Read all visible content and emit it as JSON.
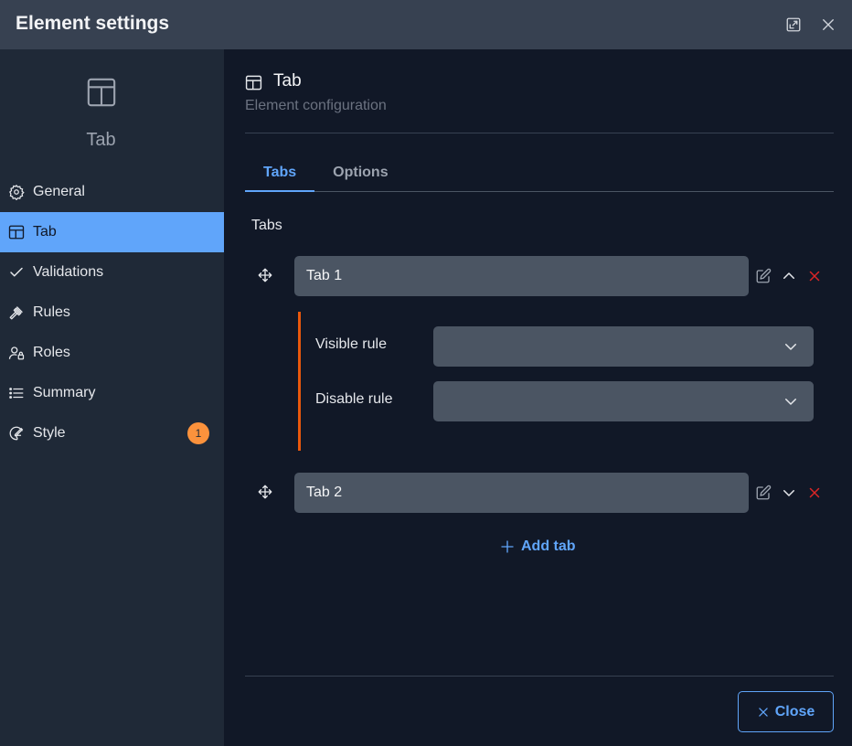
{
  "window": {
    "title": "Element settings"
  },
  "sidebar": {
    "element_label": "Tab",
    "items": [
      {
        "label": "General",
        "icon": "gear-icon"
      },
      {
        "label": "Tab",
        "icon": "tab-layout-icon",
        "active": true
      },
      {
        "label": "Validations",
        "icon": "check-icon"
      },
      {
        "label": "Rules",
        "icon": "gavel-icon"
      },
      {
        "label": "Roles",
        "icon": "user-lock-icon"
      },
      {
        "label": "Summary",
        "icon": "list-icon"
      },
      {
        "label": "Style",
        "icon": "palette-icon",
        "badge": "1"
      }
    ]
  },
  "main": {
    "title": "Tab",
    "subtitle": "Element configuration",
    "tabs": [
      {
        "label": "Tabs",
        "active": true
      },
      {
        "label": "Options"
      }
    ],
    "section_label": "Tabs",
    "tab_items": [
      {
        "value": "Tab 1",
        "expanded": true
      },
      {
        "value": "Tab 2",
        "expanded": false
      }
    ],
    "rules": {
      "visible_label": "Visible rule",
      "disable_label": "Disable rule",
      "visible_value": "",
      "disable_value": ""
    },
    "add_tab_label": "Add tab",
    "close_label": "Close"
  },
  "colors": {
    "accent": "#60a5fa",
    "badge": "#fb923c",
    "rule_border": "#ea580c",
    "delete": "#dc2626"
  }
}
